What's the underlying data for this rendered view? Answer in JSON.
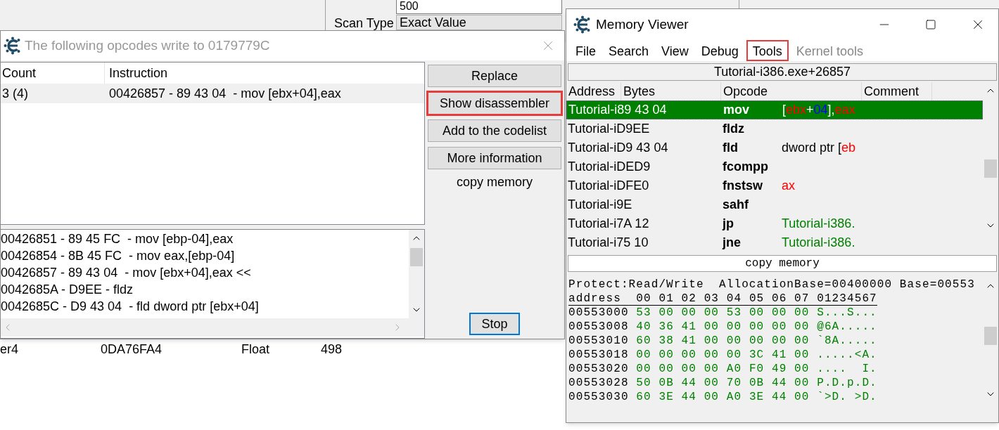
{
  "background_window": {
    "value_field": "500",
    "scan_type_label": "Scan Type",
    "scan_type_value": "Exact Value",
    "result_row": [
      "er4",
      "0DA76FA4",
      "Float",
      "498"
    ]
  },
  "opcode_window": {
    "title": "The following opcodes write to 0179779C",
    "columns": [
      "Count",
      "Instruction"
    ],
    "rows": [
      {
        "count": "3 (4)",
        "instruction": "00426857 - 89 43 04  - mov [ebx+04],eax",
        "selected": true
      }
    ],
    "buttons": [
      {
        "kind": "button",
        "label": "Replace",
        "highlighted": false
      },
      {
        "kind": "button",
        "label": "Show disassembler",
        "highlighted": true
      },
      {
        "kind": "button",
        "label": "Add to the codelist",
        "highlighted": false
      },
      {
        "kind": "button",
        "label": "More information",
        "highlighted": false
      },
      {
        "kind": "text",
        "label": "copy memory",
        "highlighted": false
      }
    ],
    "disassembly": [
      "00426851 - 89 45 FC  - mov [ebp-04],eax",
      "00426854 - 8B 45 FC  - mov eax,[ebp-04]",
      "00426857 - 89 43 04  - mov [ebx+04],eax <<",
      "0042685A - D9EE - fldz",
      "0042685C - D9 43 04  - fld dword ptr [ebx+04]"
    ],
    "stop_button": "Stop"
  },
  "memory_viewer": {
    "title": "Memory Viewer",
    "menu": [
      {
        "label": "File",
        "disabled": false,
        "highlighted": false
      },
      {
        "label": "Search",
        "disabled": false,
        "highlighted": false
      },
      {
        "label": "View",
        "disabled": false,
        "highlighted": false
      },
      {
        "label": "Debug",
        "disabled": false,
        "highlighted": false
      },
      {
        "label": "Tools",
        "disabled": false,
        "highlighted": true
      },
      {
        "label": "Kernel tools",
        "disabled": true,
        "highlighted": false
      }
    ],
    "address_bar": "Tutorial-i386.exe+26857",
    "columns": [
      "Address",
      "Bytes",
      "Opcode",
      "Comment"
    ],
    "rows": [
      {
        "address_bytes": "Tutorial-i89 43 04",
        "opcode": "mov",
        "selected": true,
        "params": [
          {
            "kind": "plain",
            "text": "["
          },
          {
            "kind": "register",
            "text": "ebx"
          },
          {
            "kind": "plain",
            "text": "+"
          },
          {
            "kind": "number",
            "text": "04"
          },
          {
            "kind": "plain",
            "text": "],"
          },
          {
            "kind": "register",
            "text": "eax"
          }
        ]
      },
      {
        "address_bytes": "Tutorial-iD9EE",
        "opcode": "fldz",
        "selected": false,
        "params": []
      },
      {
        "address_bytes": "Tutorial-iD9 43 04",
        "opcode": "fld",
        "selected": false,
        "params": [
          {
            "kind": "plain",
            "text": "dword ptr ["
          },
          {
            "kind": "register",
            "text": "eb"
          }
        ]
      },
      {
        "address_bytes": "Tutorial-iDED9",
        "opcode": "fcompp",
        "selected": false,
        "params": []
      },
      {
        "address_bytes": "Tutorial-iDFE0",
        "opcode": "fnstsw",
        "selected": false,
        "params": [
          {
            "kind": "register",
            "text": "ax"
          }
        ]
      },
      {
        "address_bytes": "Tutorial-i9E",
        "opcode": "sahf",
        "selected": false,
        "params": []
      },
      {
        "address_bytes": "Tutorial-i7A 12",
        "opcode": "jp",
        "selected": false,
        "params": [
          {
            "kind": "symbol",
            "text": "Tutorial-i386."
          }
        ]
      },
      {
        "address_bytes": "Tutorial-i75 10",
        "opcode": "jne",
        "selected": false,
        "params": [
          {
            "kind": "symbol",
            "text": "Tutorial-i386."
          }
        ]
      }
    ],
    "copy_memory": "copy memory",
    "hex_info": "Protect:Read/Write  AllocationBase=00400000 Base=00553",
    "hex_header": [
      "address",
      "00",
      "01",
      "02",
      "03",
      "04",
      "05",
      "06",
      "07",
      "01234567"
    ],
    "hex_rows": [
      {
        "address": "00553000",
        "bytes": [
          "53",
          "00",
          "00",
          "00",
          "53",
          "00",
          "00",
          "00"
        ],
        "ascii": "S...S..."
      },
      {
        "address": "00553008",
        "bytes": [
          "40",
          "36",
          "41",
          "00",
          "00",
          "00",
          "00",
          "00"
        ],
        "ascii": "@6A....."
      },
      {
        "address": "00553010",
        "bytes": [
          "60",
          "38",
          "41",
          "00",
          "00",
          "00",
          "00",
          "00"
        ],
        "ascii": "`8A....."
      },
      {
        "address": "00553018",
        "bytes": [
          "00",
          "00",
          "00",
          "00",
          "00",
          "3C",
          "41",
          "00"
        ],
        "ascii": ".....<A."
      },
      {
        "address": "00553020",
        "bytes": [
          "00",
          "00",
          "00",
          "00",
          "A0",
          "F0",
          "49",
          "00"
        ],
        "ascii": "....  I."
      },
      {
        "address": "00553028",
        "bytes": [
          "50",
          "0B",
          "44",
          "00",
          "70",
          "0B",
          "44",
          "00"
        ],
        "ascii": "P.D.p.D."
      },
      {
        "address": "00553030",
        "bytes": [
          "60",
          "3E",
          "44",
          "00",
          "A0",
          "3E",
          "44",
          "00"
        ],
        "ascii": "`>D. >D."
      }
    ]
  }
}
